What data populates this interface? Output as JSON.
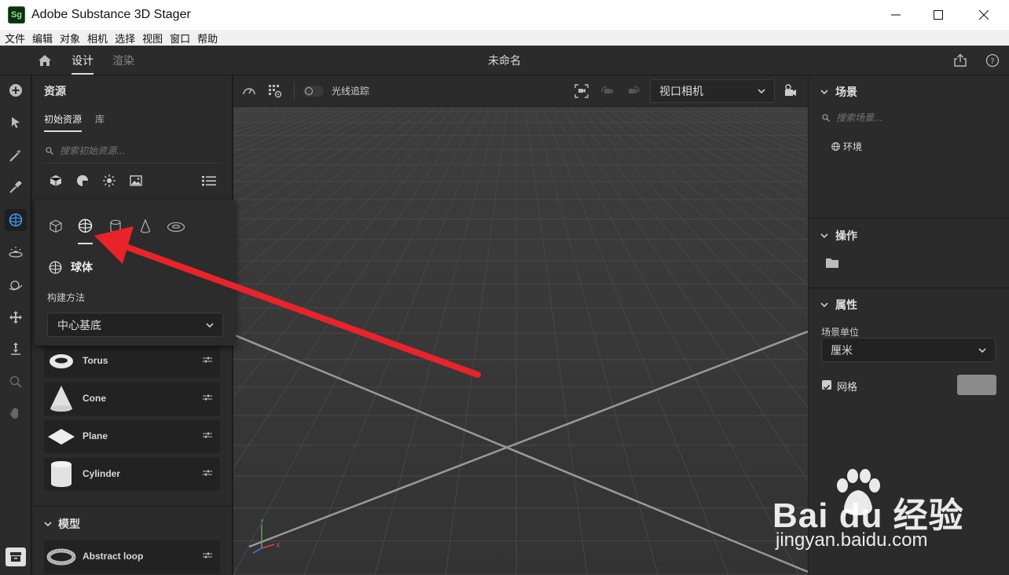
{
  "window": {
    "app_icon": "Sg",
    "title": "Adobe Substance 3D Stager"
  },
  "menu": [
    "文件",
    "编辑",
    "对象",
    "相机",
    "选择",
    "视图",
    "窗口",
    "帮助"
  ],
  "topbar": {
    "tabs": [
      "设计",
      "渲染"
    ],
    "doc_title": "未命名"
  },
  "left_panel": {
    "title": "资源",
    "tabs": [
      "初始资源",
      "库"
    ],
    "search_placeholder": "搜索初始资源...",
    "primitive_cards": [
      {
        "label": "Torus"
      },
      {
        "label": "Cone"
      },
      {
        "label": "Plane"
      },
      {
        "label": "Cylinder"
      }
    ],
    "models_section": "模型",
    "model_cards": [
      {
        "label": "Abstract loop"
      }
    ]
  },
  "popover": {
    "shape_name": "球体",
    "build_method_label": "构建方法",
    "build_method_value": "中心基底"
  },
  "viewport": {
    "raytrace_label": "光线追踪",
    "camera_select": "视口相机",
    "axis_x": "X",
    "axis_y": "Y"
  },
  "right_panel": {
    "scene_title": "场景",
    "scene_search_placeholder": "搜索场景...",
    "scene_items": [
      "环境"
    ],
    "actions_title": "操作",
    "props_title": "属性",
    "scene_unit_label": "场景单位",
    "scene_unit_value": "厘米",
    "grid_label": "网格",
    "grid_checked": true,
    "grid_color": "#8a8a8a"
  },
  "watermark": {
    "brand": "Bai du 经验",
    "url": "jingyan.baidu.com"
  },
  "colors": {
    "annotation_arrow": "#e8242a",
    "viewport_bg": "#3b3b3b",
    "panel_bg": "#2b2b2b"
  }
}
